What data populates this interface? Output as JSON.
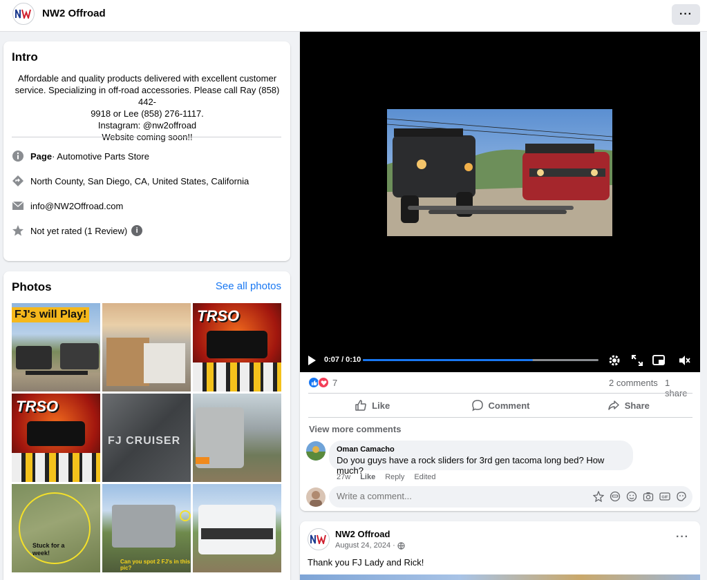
{
  "header": {
    "page_name": "NW2 Offroad",
    "logo_text": "NW",
    "more_label": "···"
  },
  "intro": {
    "title": "Intro",
    "bio_lines": [
      "Affordable and quality products delivered with excellent customer",
      "service. Specializing in off-road accessories. Please call Ray (858) 442-",
      "9918 or Lee (858) 276-1117.",
      "Instagram: @nw2offroad",
      "Website coming soon!!"
    ],
    "category_label": "Page",
    "category_value": " · Automotive Parts Store",
    "location": "North County, San Diego, CA, United States, California",
    "email": "info@NW2Offroad.com",
    "rating": "Not yet rated (1 Review)"
  },
  "photos": {
    "title": "Photos",
    "see_all": "See all photos",
    "tiles": [
      {
        "caption": "FJ's will Play!"
      },
      {
        "caption": ""
      },
      {
        "caption": "TRSO"
      },
      {
        "caption": "TRSO"
      },
      {
        "caption": "FJ CRUISER"
      },
      {
        "caption": ""
      },
      {
        "caption": "Stuck for a week!"
      },
      {
        "caption": "Can you spot 2 FJ's in this pic?"
      },
      {
        "caption": ""
      }
    ]
  },
  "video_post": {
    "timecode": "0:07 / 0:10",
    "progress": 0.72,
    "reaction_count": "7",
    "comments_count": "2 comments",
    "shares_count": "1 share",
    "actions": {
      "like": "Like",
      "comment": "Comment",
      "share": "Share"
    },
    "view_more": "View more comments",
    "comment": {
      "author": "Oman Camacho",
      "text": "Do you guys have a rock sliders for 3rd gen tacoma long bed? How much?",
      "time": "27w",
      "like": "Like",
      "reply": "Reply",
      "edited": "Edited"
    },
    "write_placeholder": "Write a comment..."
  },
  "second_post": {
    "author": "NW2 Offroad",
    "date": "August 24, 2024 ·",
    "text": "Thank you FJ Lady and Rick!",
    "more_label": "···"
  },
  "colors": {
    "accent": "#1877f2",
    "page_bg": "#f0f2f5",
    "secondary_text": "#65676b"
  }
}
